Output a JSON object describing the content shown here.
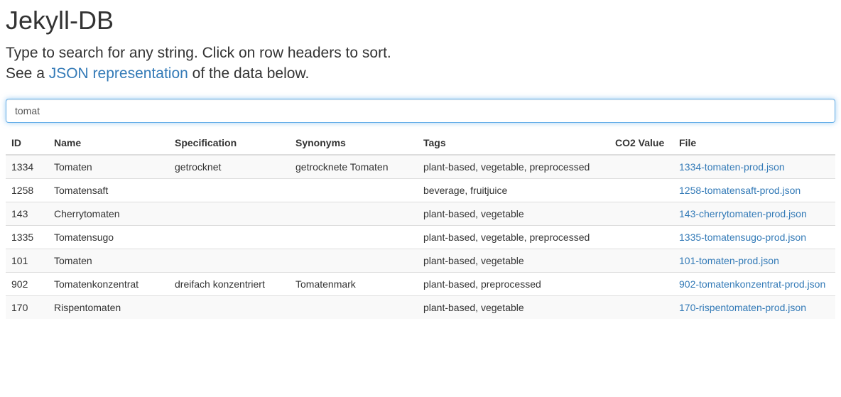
{
  "header": {
    "title": "Jekyll-DB",
    "lead_line1": "Type to search for any string. Click on row headers to sort.",
    "lead_line2_prefix": "See a ",
    "lead_line2_link": "JSON representation",
    "lead_line2_suffix": " of the data below."
  },
  "search": {
    "value": "tomat",
    "placeholder": ""
  },
  "table": {
    "columns": [
      "ID",
      "Name",
      "Specification",
      "Synonyms",
      "Tags",
      "CO2 Value",
      "File"
    ],
    "rows": [
      {
        "id": "1334",
        "name": "Tomaten",
        "specification": "getrocknet",
        "synonyms": "getrocknete Tomaten",
        "tags": "plant-based, vegetable, preprocessed",
        "co2": "",
        "file": "1334-tomaten-prod.json"
      },
      {
        "id": "1258",
        "name": "Tomatensaft",
        "specification": "",
        "synonyms": "",
        "tags": "beverage, fruitjuice",
        "co2": "",
        "file": "1258-tomatensaft-prod.json"
      },
      {
        "id": "143",
        "name": "Cherrytomaten",
        "specification": "",
        "synonyms": "",
        "tags": "plant-based, vegetable",
        "co2": "",
        "file": "143-cherrytomaten-prod.json"
      },
      {
        "id": "1335",
        "name": "Tomatensugo",
        "specification": "",
        "synonyms": "",
        "tags": "plant-based, vegetable, preprocessed",
        "co2": "",
        "file": "1335-tomatensugo-prod.json"
      },
      {
        "id": "101",
        "name": "Tomaten",
        "specification": "",
        "synonyms": "",
        "tags": "plant-based, vegetable",
        "co2": "",
        "file": "101-tomaten-prod.json"
      },
      {
        "id": "902",
        "name": "Tomatenkonzentrat",
        "specification": "dreifach konzentriert",
        "synonyms": "Tomatenmark",
        "tags": "plant-based, preprocessed",
        "co2": "",
        "file": "902-tomatenkonzentrat-prod.json"
      },
      {
        "id": "170",
        "name": "Rispentomaten",
        "specification": "",
        "synonyms": "",
        "tags": "plant-based, vegetable",
        "co2": "",
        "file": "170-rispentomaten-prod.json"
      }
    ]
  }
}
